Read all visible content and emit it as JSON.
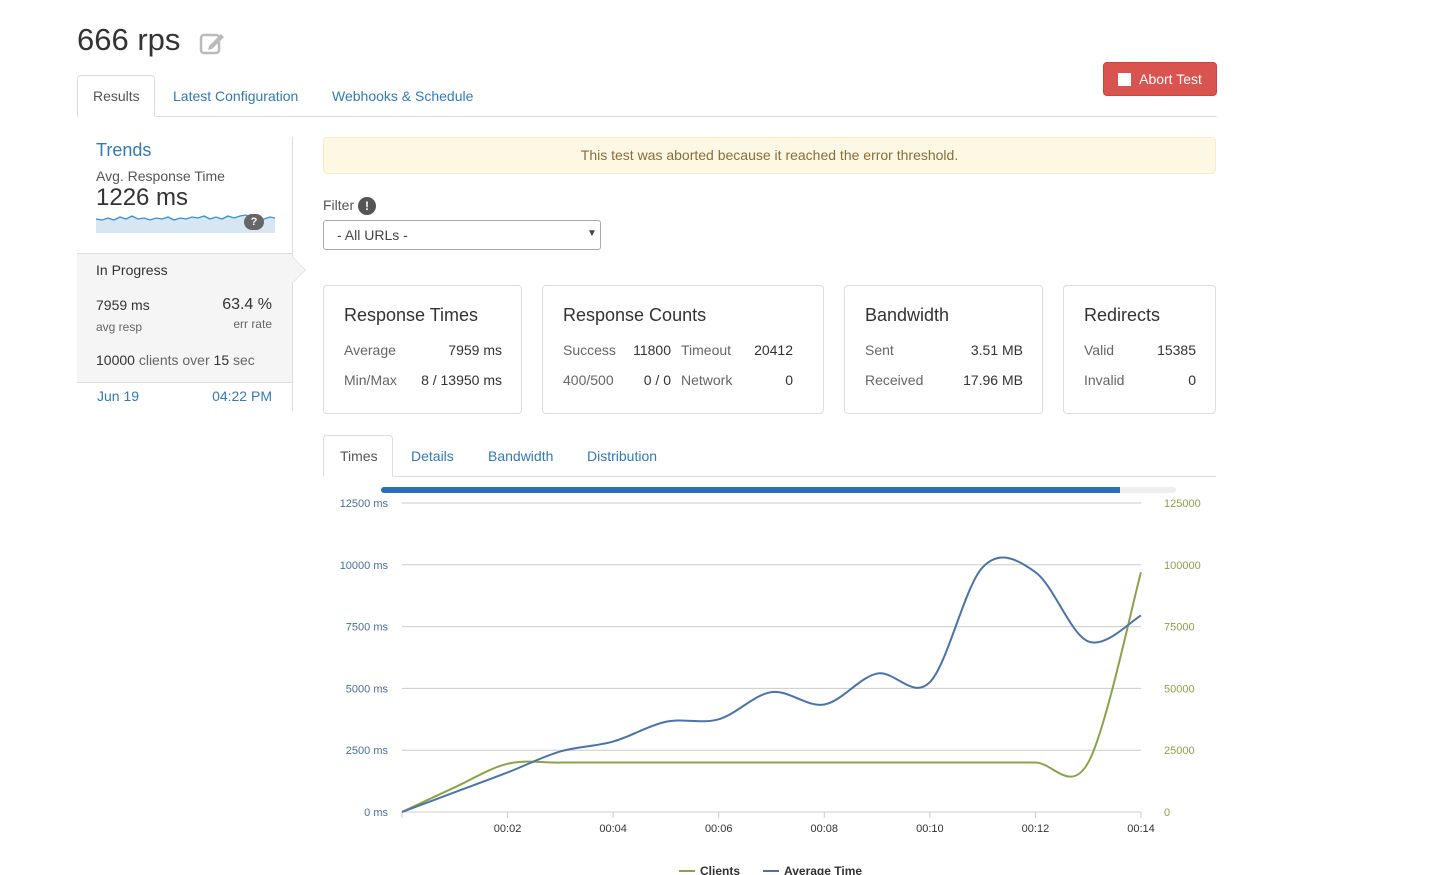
{
  "header": {
    "title": "666 rps",
    "abort_label": "Abort Test"
  },
  "tabs": [
    {
      "label": "Results",
      "active": true
    },
    {
      "label": "Latest Configuration",
      "active": false
    },
    {
      "label": "Webhooks & Schedule",
      "active": false
    }
  ],
  "sidebar": {
    "trends_title": "Trends",
    "avg_label": "Avg. Response Time",
    "avg_value": "1226 ms",
    "help": "?",
    "status": "In Progress",
    "avg_resp_value": "7959 ms",
    "avg_resp_label": "avg resp",
    "err_rate_value": "63.4 %",
    "err_rate_label": "err rate",
    "clients_count": "10000",
    "clients_mid": "clients over",
    "clients_duration": "15",
    "clients_unit": "sec",
    "date": "Jun 19",
    "time": "04:22 PM"
  },
  "alert": "This test was aborted because it reached the error threshold.",
  "filter": {
    "label": "Filter",
    "help": "!",
    "value": "- All URLs -"
  },
  "panels": {
    "response_times": {
      "title": "Response Times",
      "rows": [
        [
          "Average",
          "7959 ms"
        ],
        [
          "Min/Max",
          "8 / 13950 ms"
        ]
      ]
    },
    "response_counts": {
      "title": "Response Counts",
      "rows": [
        [
          "Success",
          "11800",
          "Timeout",
          "20412"
        ],
        [
          "400/500",
          "0 / 0",
          "Network",
          "0"
        ]
      ]
    },
    "bandwidth": {
      "title": "Bandwidth",
      "rows": [
        [
          "Sent",
          "3.51 MB"
        ],
        [
          "Received",
          "17.96 MB"
        ]
      ]
    },
    "redirects": {
      "title": "Redirects",
      "rows": [
        [
          "Valid",
          "15385"
        ],
        [
          "Invalid",
          "0"
        ]
      ]
    }
  },
  "chart_tabs": [
    {
      "label": "Times",
      "active": true
    },
    {
      "label": "Details",
      "active": false
    },
    {
      "label": "Bandwidth",
      "active": false
    },
    {
      "label": "Distribution",
      "active": false
    }
  ],
  "progress": 0.93,
  "colors": {
    "clients": "#8aa34a",
    "avg_time": "#4a74a8",
    "danger": "#d9534f",
    "link": "#337ab7"
  },
  "chart_data": {
    "type": "line",
    "x": [
      "00:00",
      "00:01",
      "00:02",
      "00:03",
      "00:04",
      "00:05",
      "00:06",
      "00:07",
      "00:08",
      "00:09",
      "00:10",
      "00:11",
      "00:12",
      "00:13",
      "00:14"
    ],
    "x_tick_labels": [
      "00:02",
      "00:04",
      "00:06",
      "00:08",
      "00:10",
      "00:12",
      "00:14"
    ],
    "y_left_ticks": [
      "0 ms",
      "2500 ms",
      "5000 ms",
      "7500 ms",
      "10000 ms",
      "12500 ms"
    ],
    "y_right_ticks": [
      "0",
      "25000",
      "50000",
      "75000",
      "100000",
      "125000"
    ],
    "ylim_left": [
      0,
      12500
    ],
    "ylim_right": [
      0,
      125000
    ],
    "series": [
      {
        "name": "Clients",
        "axis": "right",
        "values": [
          0,
          10000,
          19500,
          20000,
          20000,
          20000,
          20000,
          20000,
          20000,
          20000,
          20000,
          20000,
          20000,
          20000,
          97000
        ]
      },
      {
        "name": "Average Time",
        "axis": "left",
        "values": [
          0,
          800,
          1600,
          2450,
          2850,
          3650,
          3750,
          4850,
          4350,
          5600,
          5250,
          9900,
          9700,
          6900,
          7950
        ]
      }
    ],
    "legend_position": "bottom",
    "grid": true
  }
}
